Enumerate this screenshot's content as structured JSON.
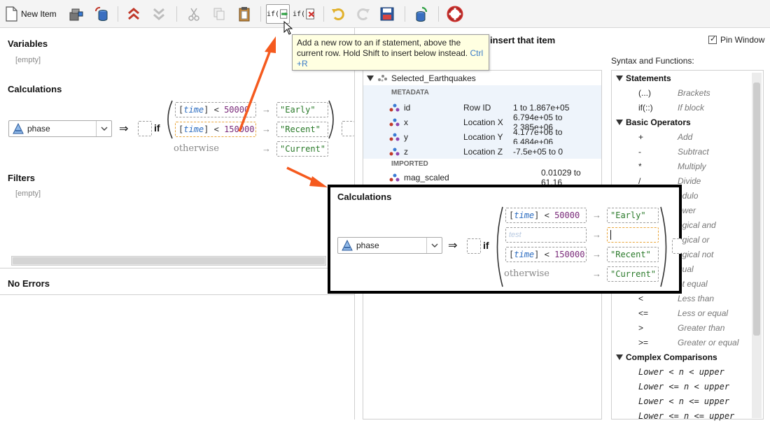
{
  "toolbar": {
    "new_item_label": "New Item",
    "if_add_label": "if(",
    "if_remove_label": "if("
  },
  "tooltip": {
    "text": "Add a new row to an if statement, above the current row. Hold Shift to insert below instead.",
    "shortcut_1": "Ctrl",
    "shortcut_2": "+R"
  },
  "left": {
    "variables_title": "Variables",
    "variables_empty": "[empty]",
    "calculations_title": "Calculations",
    "filters_title": "Filters",
    "filters_empty": "[empty]",
    "errors_title": "No Errors",
    "calc": {
      "variable": "phase",
      "implies": "⇒",
      "if_keyword": "if",
      "rows": [
        {
          "var": "time",
          "op": "<",
          "value": "50000",
          "result": "\"Early\""
        },
        {
          "var": "time",
          "op": "<",
          "value": "150000",
          "result": "\"Recent\""
        }
      ],
      "otherwise_label": "otherwise",
      "otherwise_result": "\"Current\""
    }
  },
  "right": {
    "insert_title": "insert that item",
    "pin_window": "Pin Window",
    "syntax_title": "Syntax and Functions:",
    "tree": {
      "root": "Selected_Earthquakes",
      "metadata_header": "METADATA",
      "imported_header": "IMPORTED",
      "rows": [
        {
          "name": "id",
          "desc": "Row ID",
          "range": "1 to 1.867e+05"
        },
        {
          "name": "x",
          "desc": "Location X",
          "range": "6.794e+05 to 2.385e+06"
        },
        {
          "name": "y",
          "desc": "Location Y",
          "range": "4.177e+06 to 6.484e+06"
        },
        {
          "name": "z",
          "desc": "Location Z",
          "range": "-7.5e+05 to 0"
        }
      ],
      "imported": {
        "name": "mag_scaled",
        "range": "0.01029 to 61.16"
      }
    },
    "syntax": {
      "statements": "Statements",
      "statement_rows": [
        {
          "sym": "(...)",
          "desc": "Brackets"
        },
        {
          "sym": "if(::)",
          "desc": "If block"
        }
      ],
      "basic_ops": "Basic Operators",
      "op_rows": [
        {
          "sym": "+",
          "desc": "Add"
        },
        {
          "sym": "-",
          "desc": "Subtract"
        },
        {
          "sym": "*",
          "desc": "Multiply"
        },
        {
          "sym": "/",
          "desc": "Divide"
        },
        {
          "sym": "",
          "desc": "odulo"
        },
        {
          "sym": "",
          "desc": "ower"
        },
        {
          "sym": "",
          "desc": "ogical and"
        },
        {
          "sym": "",
          "desc": "ogical or"
        },
        {
          "sym": "",
          "desc": "ogical not"
        },
        {
          "sym": "",
          "desc": "qual"
        },
        {
          "sym": "",
          "desc": "ot equal"
        },
        {
          "sym": "<",
          "desc": "Less than"
        },
        {
          "sym": "<=",
          "desc": "Less or equal"
        },
        {
          "sym": ">",
          "desc": "Greater than"
        },
        {
          "sym": ">=",
          "desc": "Greater or equal"
        }
      ],
      "complex": "Complex Comparisons",
      "complex_rows": [
        "Lower <  n <  upper",
        "Lower <= n <  upper",
        "Lower <  n <= upper",
        "Lower <= n <= upper"
      ]
    }
  },
  "callout": {
    "title": "Calculations",
    "variable": "phase",
    "implies": "⇒",
    "if_keyword": "if",
    "row1": {
      "var": "time",
      "op": "<",
      "value": "50000",
      "result": "\"Early\""
    },
    "test_placeholder": "test",
    "row3": {
      "var": "time",
      "op": "<",
      "value": "150000",
      "result": "\"Recent\""
    },
    "otherwise_label": "otherwise",
    "otherwise_result": "\"Current\""
  },
  "colors": {
    "arrow": "#f55a1e",
    "accent_orange": "#e9a53a",
    "tooltip_bg": "#ffffe1"
  }
}
